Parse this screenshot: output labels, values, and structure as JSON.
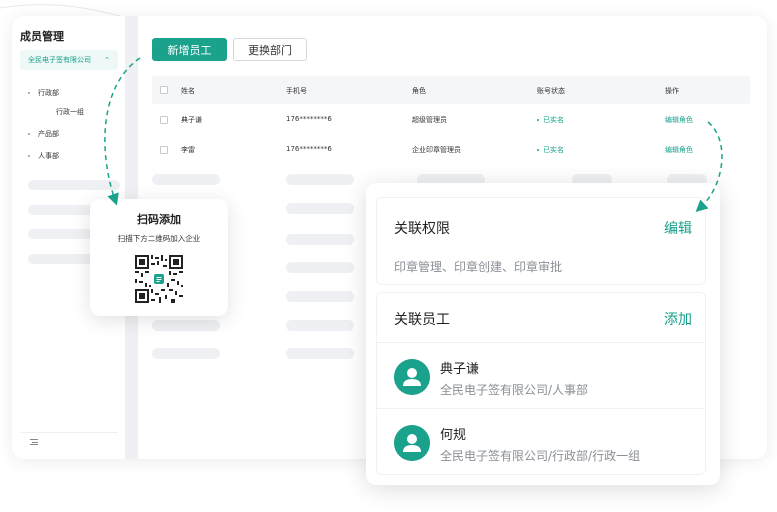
{
  "sidebar": {
    "title": "成员管理",
    "company": "全民电子签有限公司",
    "tree": [
      "行政部",
      "行政一组",
      "产品部",
      "人事部"
    ]
  },
  "toolbar": {
    "add_employee": "新增员工",
    "change_department": "更换部门"
  },
  "table": {
    "headers": [
      "姓名",
      "手机号",
      "角色",
      "账号状态",
      "操作"
    ],
    "rows": [
      {
        "name": "典子谦",
        "phone": "176********6",
        "role": "超级管理员",
        "status": "已实名",
        "action": "编辑角色"
      },
      {
        "name": "李雷",
        "phone": "176********6",
        "role": "企业印章管理员",
        "status": "已实名",
        "action": "编辑角色"
      }
    ]
  },
  "qr_popup": {
    "title": "扫码添加",
    "subtitle": "扫描下方二维码加入企业"
  },
  "panel": {
    "permissions": {
      "title": "关联权限",
      "action": "编辑",
      "items": "印章管理、印章创建、印章审批"
    },
    "employees": {
      "title": "关联员工",
      "action": "添加",
      "list": [
        {
          "name": "典子谦",
          "dept": "全民电子签有限公司/人事部"
        },
        {
          "name": "何规",
          "dept": "全民电子签有限公司/行政部/行政一组"
        }
      ]
    }
  },
  "colors": {
    "accent": "#1ba28d",
    "accent_text": "#15a08b"
  }
}
